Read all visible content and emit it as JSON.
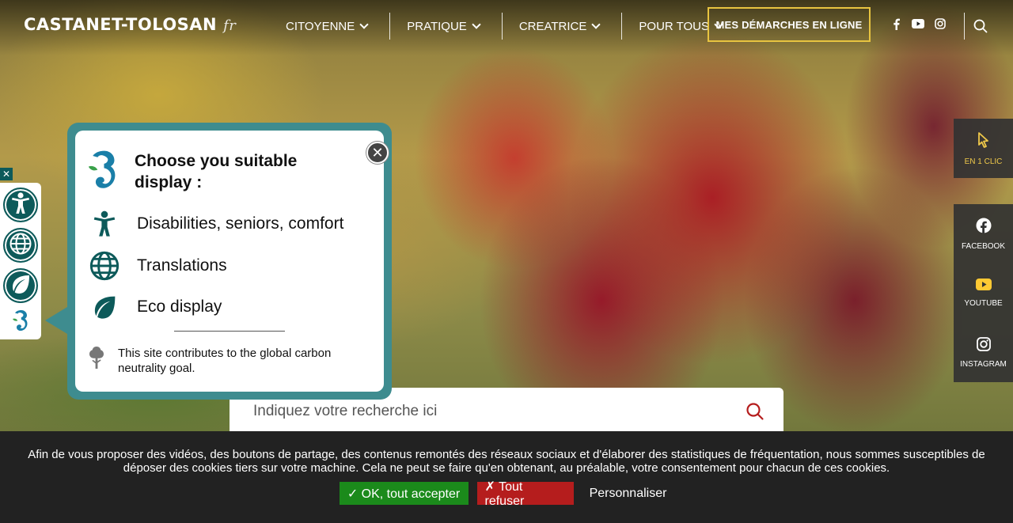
{
  "header": {
    "logo_text": "CASTANET-TOLOSAN",
    "logo_suffix": "fr",
    "nav": [
      {
        "label": "CITOYENNE"
      },
      {
        "label": "PRATIQUE"
      },
      {
        "label": "CREATRICE"
      },
      {
        "label": "POUR TOUS"
      }
    ],
    "cta_label": "MES DÉMARCHES EN LIGNE",
    "social_icons": [
      "facebook-icon",
      "youtube-icon",
      "instagram-icon"
    ],
    "search_icon": "search-icon"
  },
  "quick_links": [
    {
      "label": "EN 1 CLIC",
      "icon": "cursor-icon"
    },
    {
      "label": "FACEBOOK",
      "icon": "facebook-icon"
    },
    {
      "label": "YOUTUBE",
      "icon": "youtube-icon"
    },
    {
      "label": "INSTAGRAM",
      "icon": "instagram-icon"
    }
  ],
  "a11y_toolbar": {
    "close_glyph": "✕",
    "buttons": [
      "accessibility-icon",
      "globe-icon",
      "leaf-icon",
      "seahorse-icon"
    ]
  },
  "popup": {
    "close_glyph": "✕",
    "title": "Choose you suitable display :",
    "options": [
      {
        "label": "Disabilities, seniors, comfort",
        "icon": "accessibility-icon"
      },
      {
        "label": "Translations",
        "icon": "globe-icon"
      },
      {
        "label": "Eco display",
        "icon": "leaf-icon"
      }
    ],
    "carbon_text": "This site contributes to the global carbon neutrality goal."
  },
  "search": {
    "placeholder": "Indiquez votre recherche ici"
  },
  "cookie": {
    "message": "Afin de vous proposer des vidéos, des boutons de partage, des contenus remontés des réseaux sociaux et d'élaborer des statistiques de fréquentation, nous sommes susceptibles de déposer des cookies tiers sur votre machine. Cela ne peut se faire qu'en obtenant, au préalable, votre consentement pour chacun de ces cookies.",
    "accept_label": "✓ OK, tout accepter",
    "refuse_label": "✗ Tout refuser",
    "customize_label": "Personnaliser"
  },
  "colors": {
    "accent_yellow": "#e8c440",
    "teal": "#0d5a5a",
    "popup_border": "#3e8c8f",
    "accept_green": "#1b8a1b",
    "refuse_red": "#b51d1d"
  }
}
